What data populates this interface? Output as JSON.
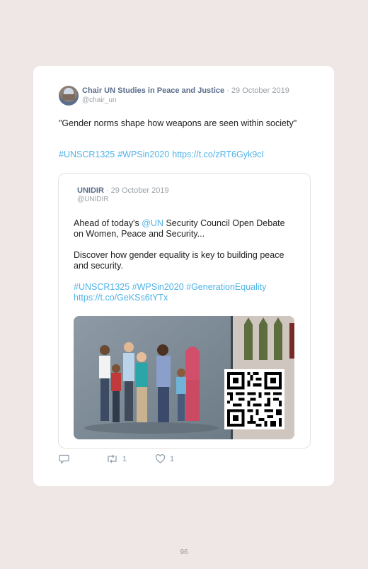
{
  "tweet": {
    "author_name": "Chair UN Studies in Peace and Justice",
    "date": "· 29 October 2019",
    "handle": "@chair_un",
    "text": "\"Gender norms shape how weapons are seen within society\"",
    "hashtags": [
      "#UNSCR1325",
      "#WPSin2020",
      "https://t.co/zRT6Gyk9cI"
    ]
  },
  "quoted_tweet": {
    "author_name": "UNIDIR",
    "date": "· 29 October 2019",
    "handle": "@UNIDIR",
    "text_before_mention": "Ahead of today's ",
    "mention": "@UN",
    "text_after_mention": " Security Council Open Debate on Women, Peace and Security...",
    "paragraph2": "Discover how gender equality is key to building peace and security.",
    "tags_line": "#UNSCR1325 #WPSin2020 #GenerationEquality",
    "link": "https://t.co/GeKSs6tYTx"
  },
  "actions": {
    "reply_icon": "reply-icon",
    "retweet_icon": "retweet-icon",
    "retweet_count": "1",
    "like_icon": "heart-icon",
    "like_count": "1"
  },
  "page_number": "96",
  "colors": {
    "link": "#4fb3e8",
    "author": "#5a6d8a",
    "background": "#efe6e6"
  }
}
